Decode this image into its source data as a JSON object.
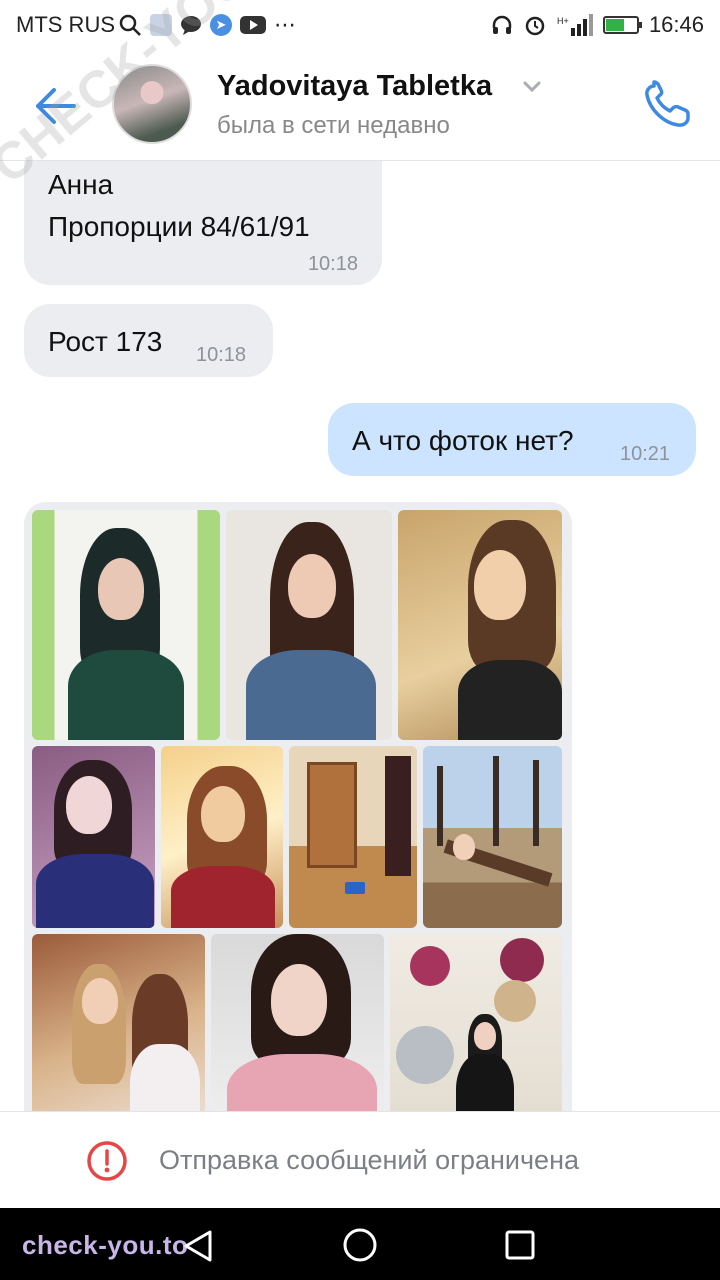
{
  "status_bar": {
    "carrier": "MTS RUS",
    "time": "16:46"
  },
  "header": {
    "contact_name": "Yadovitaya Tabletka",
    "contact_status": "была в сети недавно"
  },
  "messages": [
    {
      "direction": "incoming",
      "lines": [
        "Анна",
        "Пропорции 84/61/91"
      ],
      "time": "10:18"
    },
    {
      "direction": "incoming",
      "lines": [
        "Рост 173"
      ],
      "time": "10:18"
    },
    {
      "direction": "outgoing",
      "lines": [
        "А что фоток нет?"
      ],
      "time": "10:21"
    }
  ],
  "photo_album": {
    "photo_count": 10
  },
  "restriction": {
    "text": "Отправка сообщений ограничена"
  },
  "watermarks": {
    "bottom": "check-you.to",
    "diagonal": "CHECK-YOU.ME"
  },
  "colors": {
    "accent": "#3f8ae0",
    "incoming_bubble": "#ebedf0",
    "outgoing_bubble": "#cce4ff",
    "error": "#e64646"
  },
  "icons": [
    "search-icon",
    "shield-icon",
    "chat-icon",
    "telegram-icon",
    "youtube-icon",
    "more-icon",
    "headphones-icon",
    "alarm-icon",
    "signal-icon",
    "battery-icon",
    "back-arrow-icon",
    "chevron-down-icon",
    "phone-icon",
    "alert-icon",
    "nav-back-icon",
    "nav-home-icon",
    "nav-recent-icon"
  ]
}
